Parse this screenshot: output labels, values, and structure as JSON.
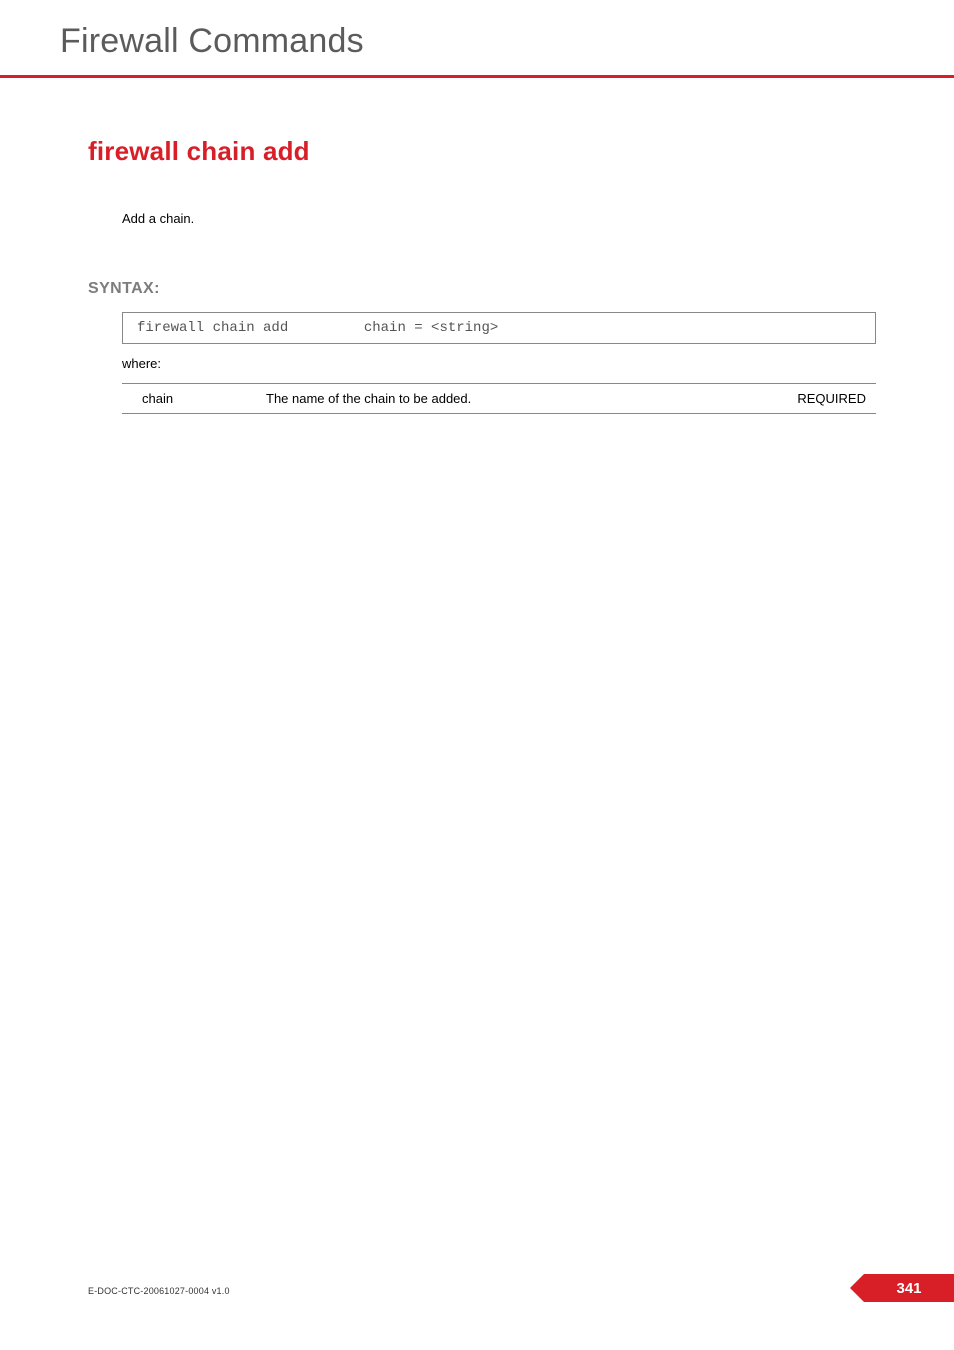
{
  "header": {
    "section_title": "Firewall Commands"
  },
  "command": {
    "title": "firewall chain add",
    "description": "Add a chain."
  },
  "syntax": {
    "label": "SYNTAX:",
    "line": "firewall chain add         chain = <string>",
    "where_label": "where:"
  },
  "params": [
    {
      "name": "chain",
      "description": "The name of the chain to be added.",
      "required": "REQUIRED"
    }
  ],
  "footer": {
    "docid": "E-DOC-CTC-20061027-0004 v1.0",
    "page": "341"
  }
}
